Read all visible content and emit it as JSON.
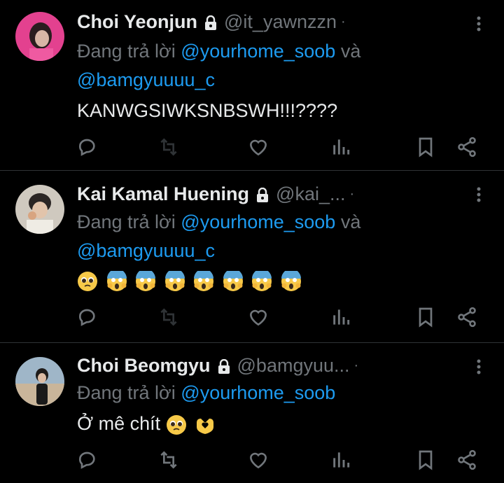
{
  "tweets": [
    {
      "name": "Choi Yeonjun",
      "handle": "@it_yawnzzn",
      "separator": "·",
      "reply_prefix": "Đang trả lời",
      "mention1": "@yourhome_soob",
      "conj": "và",
      "mention2": "@bamgyuuuu_c",
      "text": "KANWGSIWKSNBSWH!!!????",
      "emoji": []
    },
    {
      "name": "Kai Kamal Huening",
      "handle": "@kai_...",
      "separator": "·",
      "reply_prefix": "Đang trả lời",
      "mention1": "@yourhome_soob",
      "conj": "và",
      "mention2": "@bamgyuuuu_c",
      "text": "",
      "emoji": [
        "pleading-face",
        "screaming-face",
        "screaming-face",
        "screaming-face",
        "screaming-face",
        "screaming-face",
        "screaming-face",
        "screaming-face"
      ]
    },
    {
      "name": "Choi Beomgyu",
      "handle": "@bamgyuu...",
      "separator": "·",
      "reply_prefix": "Đang trả lời",
      "mention1": "@yourhome_soob",
      "conj": "",
      "mention2": "",
      "text": "Ở mê chít",
      "emoji": [
        "pleading-face",
        "heart-hands"
      ]
    }
  ],
  "colors": {
    "background": "#000000",
    "mention": "#1d9bf0",
    "muted": "#71767b",
    "text": "#e7e9ea"
  }
}
